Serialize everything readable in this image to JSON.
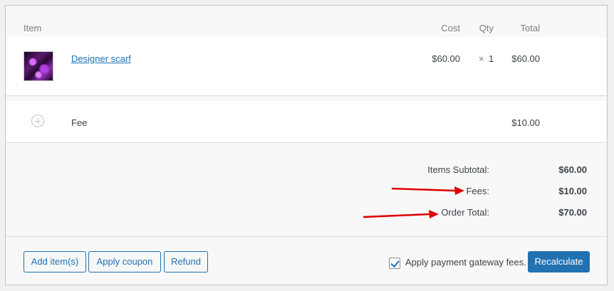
{
  "table": {
    "headers": {
      "item": "Item",
      "cost": "Cost",
      "qty": "Qty",
      "total": "Total"
    },
    "line_item": {
      "name": "Designer scarf",
      "cost": "$60.00",
      "qty_sign": "×",
      "qty": "1",
      "total": "$60.00"
    },
    "fee_row": {
      "label": "Fee",
      "total": "$10.00"
    }
  },
  "totals": {
    "subtotal_label": "Items Subtotal:",
    "subtotal_value": "$60.00",
    "fees_label": "Fees:",
    "fees_value": "$10.00",
    "order_total_label": "Order Total:",
    "order_total_value": "$70.00"
  },
  "actions": {
    "add_items": "Add item(s)",
    "apply_coupon": "Apply coupon",
    "refund": "Refund",
    "gateway_fees_label": "Apply payment gateway fees.",
    "gateway_fees_checked": true,
    "recalculate": "Recalculate"
  },
  "colors": {
    "accent": "#2271b1",
    "annotation_arrow": "#e00000"
  }
}
